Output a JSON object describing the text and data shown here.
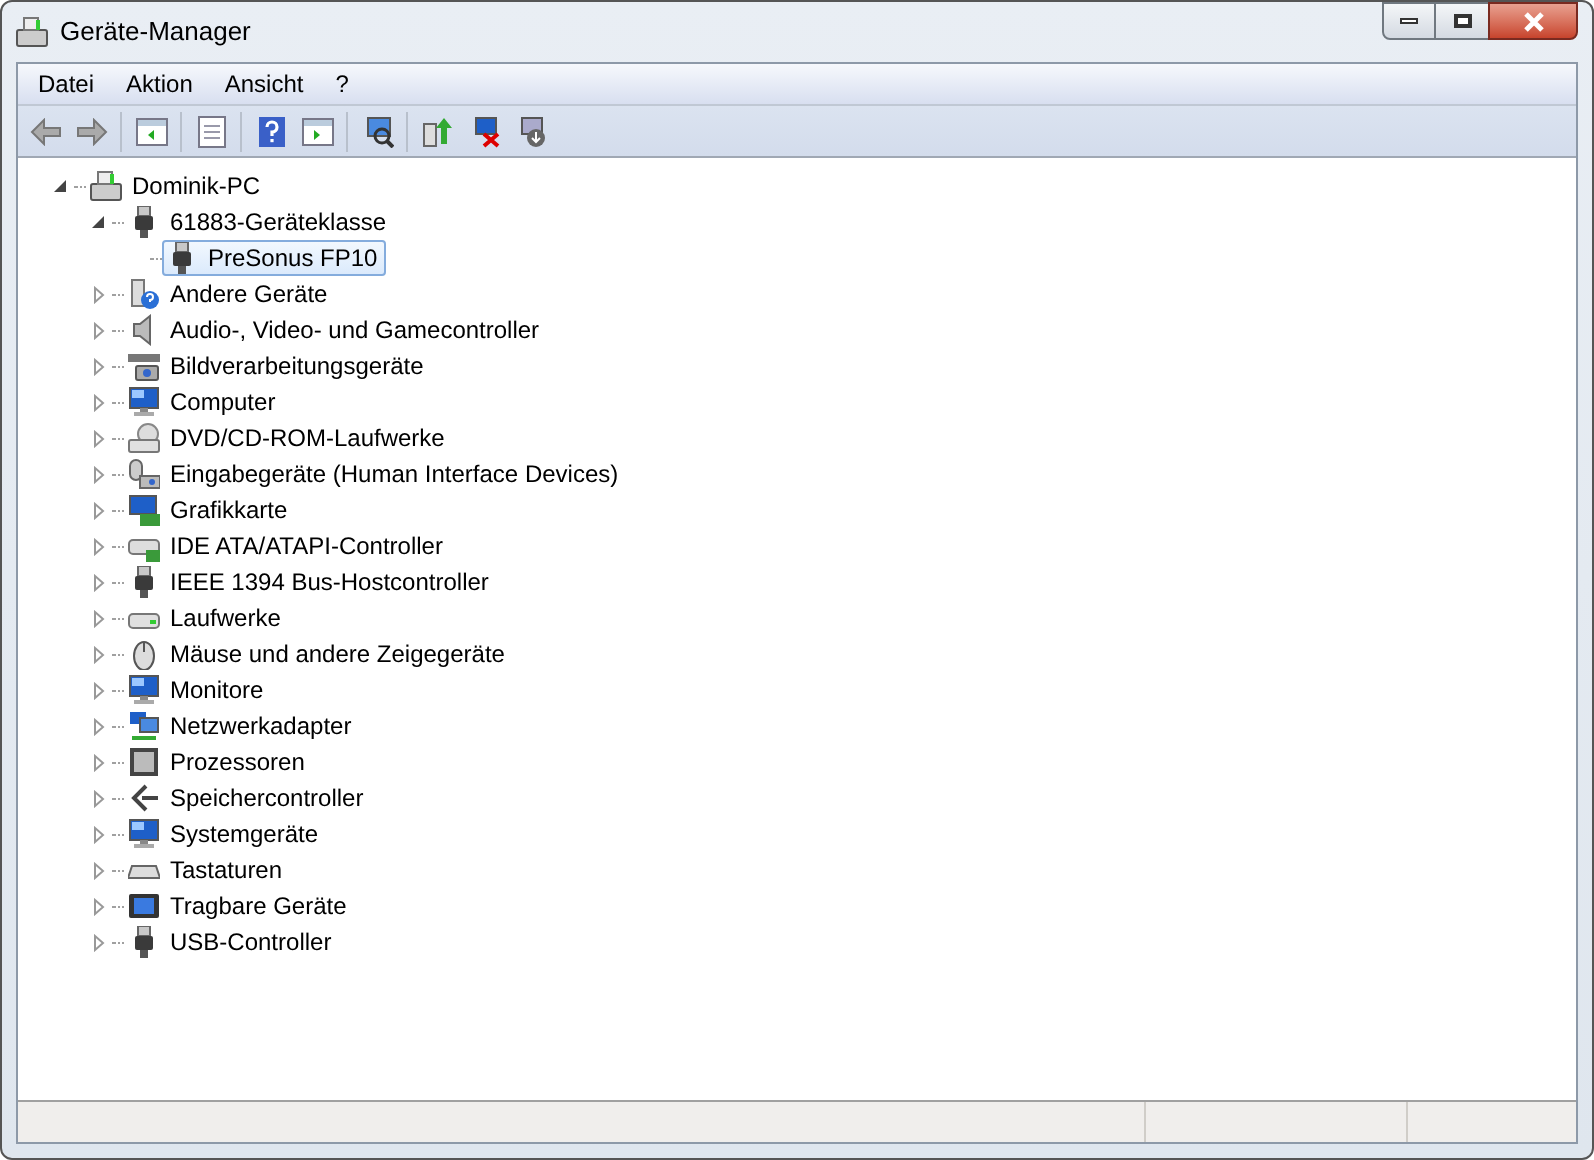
{
  "window": {
    "title": "Geräte-Manager"
  },
  "menu": [
    {
      "label": "Datei"
    },
    {
      "label": "Aktion"
    },
    {
      "label": "Ansicht"
    },
    {
      "label": "?"
    }
  ],
  "tree": [
    {
      "label": "Dominik-PC",
      "expanded": true,
      "selected": false,
      "children": [
        {
          "label": "61883-Geräteklasse",
          "expanded": true,
          "selected": false,
          "children": [
            {
              "label": "PreSonus FP10",
              "selected": true
            }
          ]
        },
        {
          "label": "Andere Geräte",
          "expanded": false,
          "selected": false
        },
        {
          "label": "Audio-, Video- und Gamecontroller",
          "expanded": false,
          "selected": false
        },
        {
          "label": "Bildverarbeitungsgeräte",
          "expanded": false,
          "selected": false
        },
        {
          "label": "Computer",
          "expanded": false,
          "selected": false
        },
        {
          "label": "DVD/CD-ROM-Laufwerke",
          "expanded": false,
          "selected": false
        },
        {
          "label": "Eingabegeräte (Human Interface Devices)",
          "expanded": false,
          "selected": false
        },
        {
          "label": "Grafikkarte",
          "expanded": false,
          "selected": false
        },
        {
          "label": "IDE ATA/ATAPI-Controller",
          "expanded": false,
          "selected": false
        },
        {
          "label": "IEEE 1394 Bus-Hostcontroller",
          "expanded": false,
          "selected": false
        },
        {
          "label": "Laufwerke",
          "expanded": false,
          "selected": false
        },
        {
          "label": "Mäuse und andere Zeigegeräte",
          "expanded": false,
          "selected": false
        },
        {
          "label": "Monitore",
          "expanded": false,
          "selected": false
        },
        {
          "label": "Netzwerkadapter",
          "expanded": false,
          "selected": false
        },
        {
          "label": "Prozessoren",
          "expanded": false,
          "selected": false
        },
        {
          "label": "Speichercontroller",
          "expanded": false,
          "selected": false
        },
        {
          "label": "Systemgeräte",
          "expanded": false,
          "selected": false
        },
        {
          "label": "Tastaturen",
          "expanded": false,
          "selected": false
        },
        {
          "label": "Tragbare Geräte",
          "expanded": false,
          "selected": false
        },
        {
          "label": "USB-Controller",
          "expanded": false,
          "selected": false
        }
      ]
    }
  ]
}
